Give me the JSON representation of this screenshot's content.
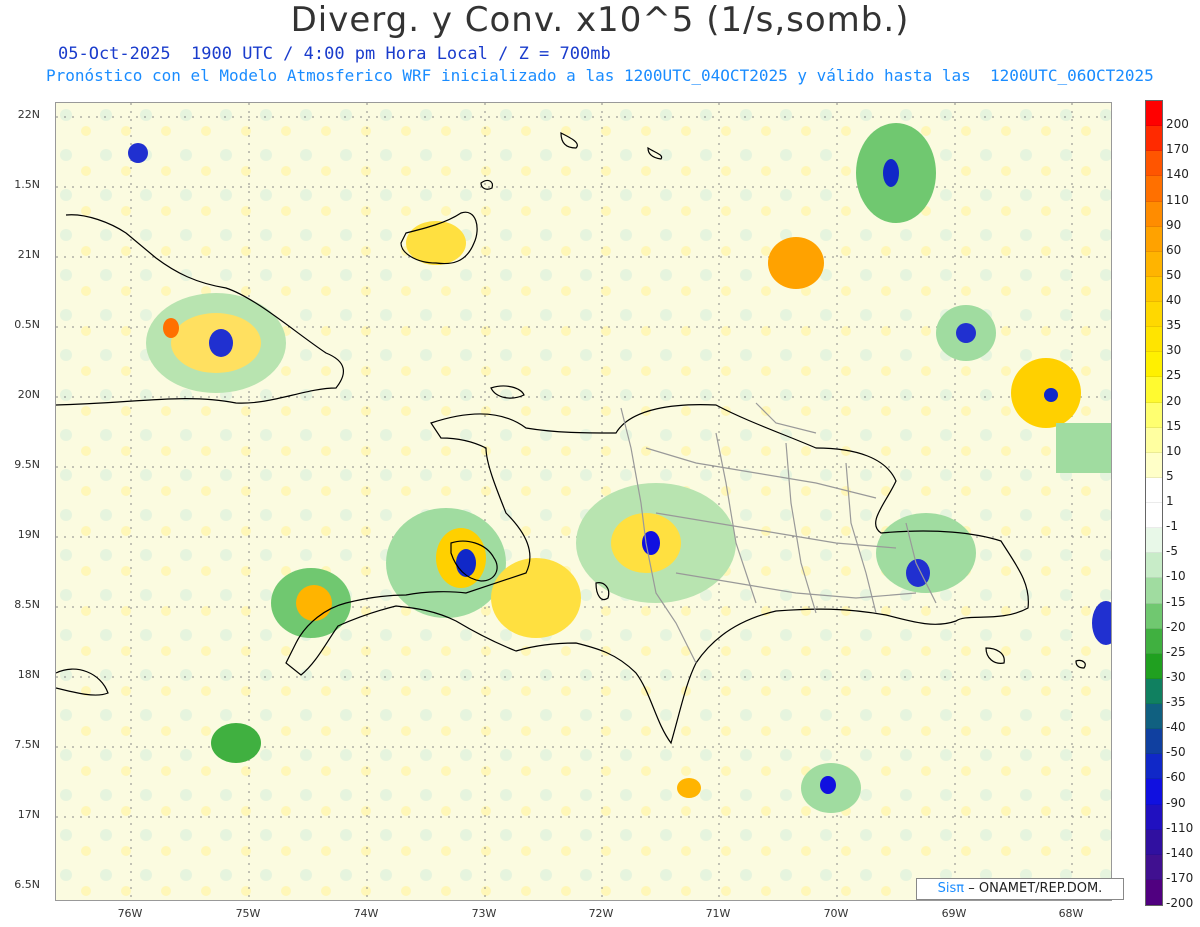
{
  "header": {
    "title": "Diverg. y Conv. x10^5 (1/s,somb.)",
    "subtitle_line1": "05-Oct-2025  1900 UTC / 4:00 pm Hora Local / Z = 700mb",
    "subtitle_line2": "Pronóstico con el Modelo Atmosferico WRF inicializado a las 1200UTC_04OCT2025 y válido hasta las  1200UTC_06OCT2025"
  },
  "axes": {
    "y_ticks": [
      "22N",
      "1.5N",
      "21N",
      "0.5N",
      "20N",
      "9.5N",
      "19N",
      "8.5N",
      "18N",
      "7.5N",
      "17N",
      "6.5N"
    ],
    "x_ticks": [
      "76W",
      "75W",
      "74W",
      "73W",
      "72W",
      "71W",
      "70W",
      "69W",
      "68W"
    ]
  },
  "colorbar": {
    "labels": [
      "200",
      "170",
      "140",
      "110",
      "90",
      "60",
      "50",
      "40",
      "35",
      "30",
      "25",
      "20",
      "15",
      "10",
      "5",
      "1",
      "-1",
      "-5",
      "-10",
      "-15",
      "-20",
      "-25",
      "-30",
      "-35",
      "-40",
      "-50",
      "-60",
      "-90",
      "-110",
      "-140",
      "-170",
      "-200"
    ],
    "colors": [
      "#ff0000",
      "#ff2a00",
      "#ff5500",
      "#ff7000",
      "#ff8c00",
      "#ffa200",
      "#ffb400",
      "#ffc800",
      "#ffd800",
      "#ffe400",
      "#fff000",
      "#fffa30",
      "#ffff70",
      "#ffffa0",
      "#ffffc8",
      "#ffffff",
      "#ffffff",
      "#e8f8e8",
      "#c8ecc8",
      "#a0dca0",
      "#70c870",
      "#40b040",
      "#20a020",
      "#108060",
      "#106080",
      "#1040a0",
      "#1028c8",
      "#1010e0",
      "#2010c0",
      "#3010a0",
      "#401090",
      "#500080"
    ]
  },
  "credit": {
    "sis": "Sisπ",
    "text": "– ONAMET/REP.DOM."
  }
}
